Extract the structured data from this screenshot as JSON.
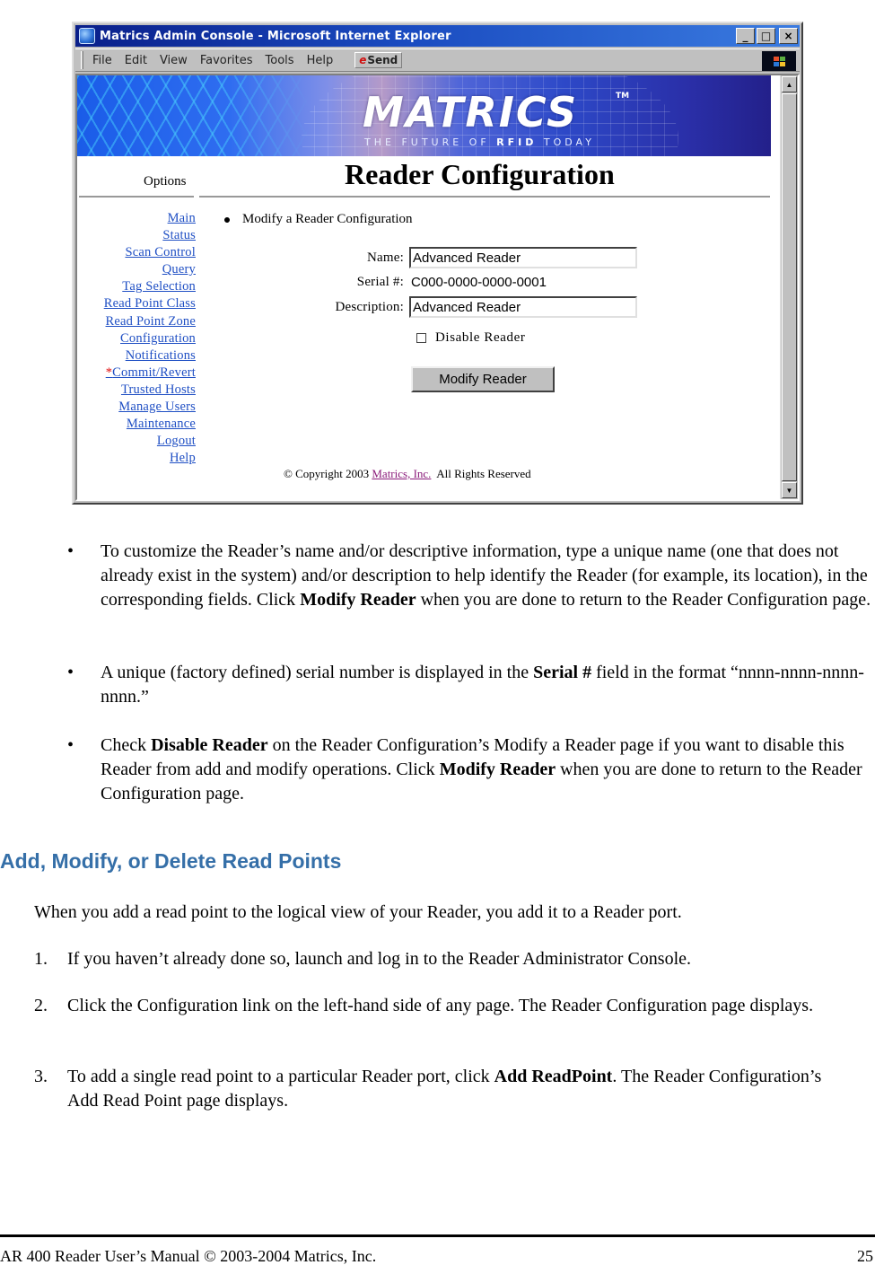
{
  "window": {
    "title": "Matrics Admin Console - Microsoft Internet Explorer",
    "controls": {
      "minimize": "_",
      "maximize": "□",
      "close": "×"
    },
    "menu": [
      "File",
      "Edit",
      "View",
      "Favorites",
      "Tools",
      "Help"
    ],
    "send_button": "Send",
    "send_glyph": "e"
  },
  "webpage": {
    "banner": {
      "logo": "MATRICS",
      "trademark": "TM",
      "tagline_pre": "THE FUTURE OF ",
      "tagline_bold": "RFID",
      "tagline_post": " TODAY"
    },
    "options_label": "Options",
    "page_title": "Reader Configuration",
    "nav": [
      {
        "label": "Main",
        "marked": false
      },
      {
        "label": "Status",
        "marked": false
      },
      {
        "label": "Scan Control",
        "marked": false
      },
      {
        "label": "Query",
        "marked": false
      },
      {
        "label": "Tag Selection",
        "marked": false
      },
      {
        "label": "Read Point Class",
        "marked": false
      },
      {
        "label": "Read Point Zone",
        "marked": false
      },
      {
        "label": "Configuration",
        "marked": false
      },
      {
        "label": "Notifications",
        "marked": false
      },
      {
        "label": "Commit/Revert",
        "marked": true,
        "marker": "*"
      },
      {
        "label": "Trusted Hosts",
        "marked": false
      },
      {
        "label": "Manage Users",
        "marked": false
      },
      {
        "label": "Maintenance",
        "marked": false
      },
      {
        "label": "Logout",
        "marked": false
      },
      {
        "label": "Help",
        "marked": false
      }
    ],
    "section_title": "Modify a Reader Configuration",
    "form": {
      "name_label": "Name:",
      "name_value": "Advanced Reader",
      "serial_label": "Serial #:",
      "serial_value": "C000-0000-0000-0001",
      "description_label": "Description:",
      "description_value": "Advanced Reader",
      "disable_label": "Disable Reader",
      "disable_checked": false,
      "submit_label": "Modify Reader"
    },
    "copyright": {
      "prefix": "© Copyright 2003 ",
      "link": "Matrics, Inc.",
      "suffix": "  All Rights Reserved"
    }
  },
  "document": {
    "bullets": [
      {
        "parts": [
          {
            "text": "To customize the Reader’s name and/or descriptive information, type a unique name (one that does not already exist in the system) and/or description to help identify the Reader (for example, its location), in the corresponding fields. Click ",
            "bold": false
          },
          {
            "text": "Modify Reader",
            "bold": true
          },
          {
            "text": " when you are done to return to the Reader Configuration page.",
            "bold": false
          }
        ]
      },
      {
        "parts": [
          {
            "text": "A unique (factory defined) serial number is displayed in the ",
            "bold": false
          },
          {
            "text": "Serial #",
            "bold": true
          },
          {
            "text": " field in the format “nnnn-nnnn-nnnn-nnnn.”",
            "bold": false
          }
        ]
      },
      {
        "parts": [
          {
            "text": "Check ",
            "bold": false
          },
          {
            "text": "Disable Reader",
            "bold": true
          },
          {
            "text": " on the Reader Configuration’s Modify a Reader page if you want to disable this Reader from add and modify operations. Click ",
            "bold": false
          },
          {
            "text": "Modify Reader",
            "bold": true
          },
          {
            "text": " when you are done to return to the Reader Configuration page.",
            "bold": false
          }
        ]
      }
    ],
    "bullet_glyph": "•",
    "section_heading": "Add, Modify, or Delete Read Points",
    "intro": "When you add a read point to the logical view of your Reader, you add it to a Reader port.",
    "steps": [
      {
        "num": "1.",
        "parts": [
          {
            "text": "If you haven’t already done so, launch and log in to the Reader Administrator Console.",
            "bold": false
          }
        ]
      },
      {
        "num": "2.",
        "parts": [
          {
            "text": "Click the Configuration link on the left-hand side of any page. The Reader Configuration page displays.",
            "bold": false
          }
        ]
      },
      {
        "num": "3.",
        "parts": [
          {
            "text": "To add a single read point to a particular Reader port, click ",
            "bold": false
          },
          {
            "text": "Add ReadPoint",
            "bold": true
          },
          {
            "text": ". The Reader Configuration’s Add Read Point page displays.",
            "bold": false
          }
        ]
      }
    ],
    "footer": {
      "left": "AR 400 Reader User’s Manual © 2003-2004 Matrics, Inc.",
      "page_number": "25"
    }
  },
  "colors": {
    "link": "#1f4fc4",
    "visited_link": "#8a1a7a",
    "heading": "#356fa8",
    "titlebar": "#0a1f8a",
    "required_marker": "#e01010"
  }
}
